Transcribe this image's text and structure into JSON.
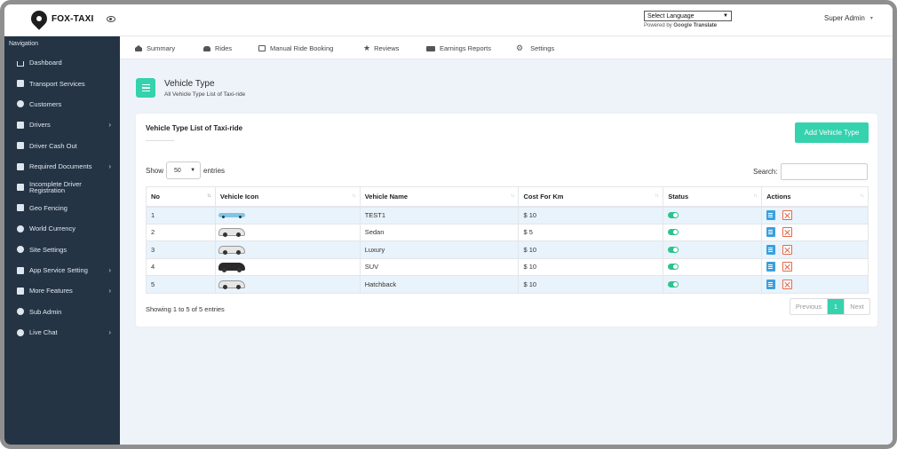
{
  "header": {
    "brand": "FOX-TAXI",
    "language_select": "Select Language",
    "powered_by": "Powered by",
    "google": "Google",
    "translate": "Translate",
    "user": "Super Admin"
  },
  "sidebar": {
    "heading": "Navigation",
    "items": [
      {
        "label": "Dashboard",
        "icon": "home-icon",
        "arrow": false
      },
      {
        "label": "Transport Services",
        "icon": "car-icon",
        "arrow": false
      },
      {
        "label": "Customers",
        "icon": "users-icon",
        "arrow": false
      },
      {
        "label": "Drivers",
        "icon": "driver-icon",
        "arrow": true
      },
      {
        "label": "Driver Cash Out",
        "icon": "cash-icon",
        "arrow": false
      },
      {
        "label": "Required Documents",
        "icon": "document-icon",
        "arrow": true
      },
      {
        "label": "Incomplete Driver Registration",
        "icon": "wrench-icon",
        "arrow": false
      },
      {
        "label": "Geo Fencing",
        "icon": "map-icon",
        "arrow": false
      },
      {
        "label": "World Currency",
        "icon": "globe-icon",
        "arrow": false
      },
      {
        "label": "Site Settings",
        "icon": "settings-icon",
        "arrow": false
      },
      {
        "label": "App Service Setting",
        "icon": "tools-icon",
        "arrow": true
      },
      {
        "label": "More Features",
        "icon": "list-icon",
        "arrow": true
      },
      {
        "label": "Sub Admin",
        "icon": "user-icon",
        "arrow": false
      },
      {
        "label": "Live Chat",
        "icon": "chat-icon",
        "arrow": true
      }
    ]
  },
  "tabs": [
    {
      "label": "Summary",
      "icon": "home-icon"
    },
    {
      "label": "Rides",
      "icon": "car-icon"
    },
    {
      "label": "Manual Ride Booking",
      "icon": "edit-icon"
    },
    {
      "label": "Reviews",
      "icon": "star-icon"
    },
    {
      "label": "Earnings Reports",
      "icon": "money-icon"
    },
    {
      "label": "Settings",
      "icon": "gear-icon"
    }
  ],
  "page": {
    "title": "Vehicle Type",
    "subtitle": "All Vehicle Type List of Taxi-ride"
  },
  "card": {
    "title": "Vehicle Type List of Taxi-ride",
    "add_button": "Add Vehicle Type",
    "show_label": "Show",
    "entries_value": "50",
    "entries_label": "entries",
    "search_label": "Search:",
    "search_value": ""
  },
  "table": {
    "columns": [
      "No",
      "Vehicle Icon",
      "Vehicle Name",
      "Cost For Km",
      "Status",
      "Actions"
    ],
    "rows": [
      {
        "no": "1",
        "icon": "blue-limo-icon",
        "name": "TEST1",
        "cost": "$ 10",
        "status": true
      },
      {
        "no": "2",
        "icon": "white-sedan-icon",
        "name": "Sedan",
        "cost": "$ 5",
        "status": true
      },
      {
        "no": "3",
        "icon": "white-car-icon",
        "name": "Luxury",
        "cost": "$ 10",
        "status": true
      },
      {
        "no": "4",
        "icon": "black-suv-icon",
        "name": "SUV",
        "cost": "$ 10",
        "status": true
      },
      {
        "no": "5",
        "icon": "white-hatchback-icon",
        "name": "Hatchback",
        "cost": "$ 10",
        "status": true
      }
    ]
  },
  "footer": {
    "info": "Showing 1 to 5 of 5 entries",
    "previous": "Previous",
    "page": "1",
    "next": "Next"
  },
  "colors": {
    "accent": "#34d2ad",
    "sidebar": "#243445",
    "content_bg": "#eef3fa",
    "status_on": "#2ec38e"
  }
}
